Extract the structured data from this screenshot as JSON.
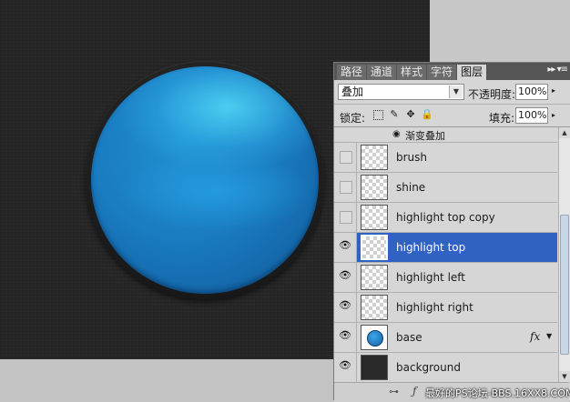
{
  "panel": {
    "tabs": [
      "路径",
      "通道",
      "样式",
      "字符",
      "图层"
    ],
    "active_tab_index": 4,
    "blend_mode": "叠加",
    "opacity_label": "不透明度:",
    "opacity_value": "100%",
    "lock_label": "锁定:",
    "fill_label": "填充:",
    "fill_value": "100%",
    "effect_label": "渐变叠加",
    "watermark": "最好的PS论坛-BBS.16XX8.COM"
  },
  "layers": [
    {
      "name": "brush",
      "visible": false,
      "selected": false,
      "thumb": "transparent"
    },
    {
      "name": "shine",
      "visible": false,
      "selected": false,
      "thumb": "transparent"
    },
    {
      "name": "highlight top copy",
      "visible": false,
      "selected": false,
      "thumb": "transparent"
    },
    {
      "name": "highlight top",
      "visible": true,
      "selected": true,
      "thumb": "transparent"
    },
    {
      "name": "highlight left",
      "visible": true,
      "selected": false,
      "thumb": "transparent"
    },
    {
      "name": "highlight right",
      "visible": true,
      "selected": false,
      "thumb": "transparent"
    },
    {
      "name": "base",
      "visible": true,
      "selected": false,
      "thumb": "blue-circle",
      "fx": "fx"
    },
    {
      "name": "background",
      "visible": true,
      "selected": false,
      "thumb": "dark"
    }
  ],
  "colors": {
    "selection": "#2f62c2",
    "canvas": "#262626",
    "orb_main": "#1a7cc1",
    "orb_highlight": "#5ae6ff"
  }
}
